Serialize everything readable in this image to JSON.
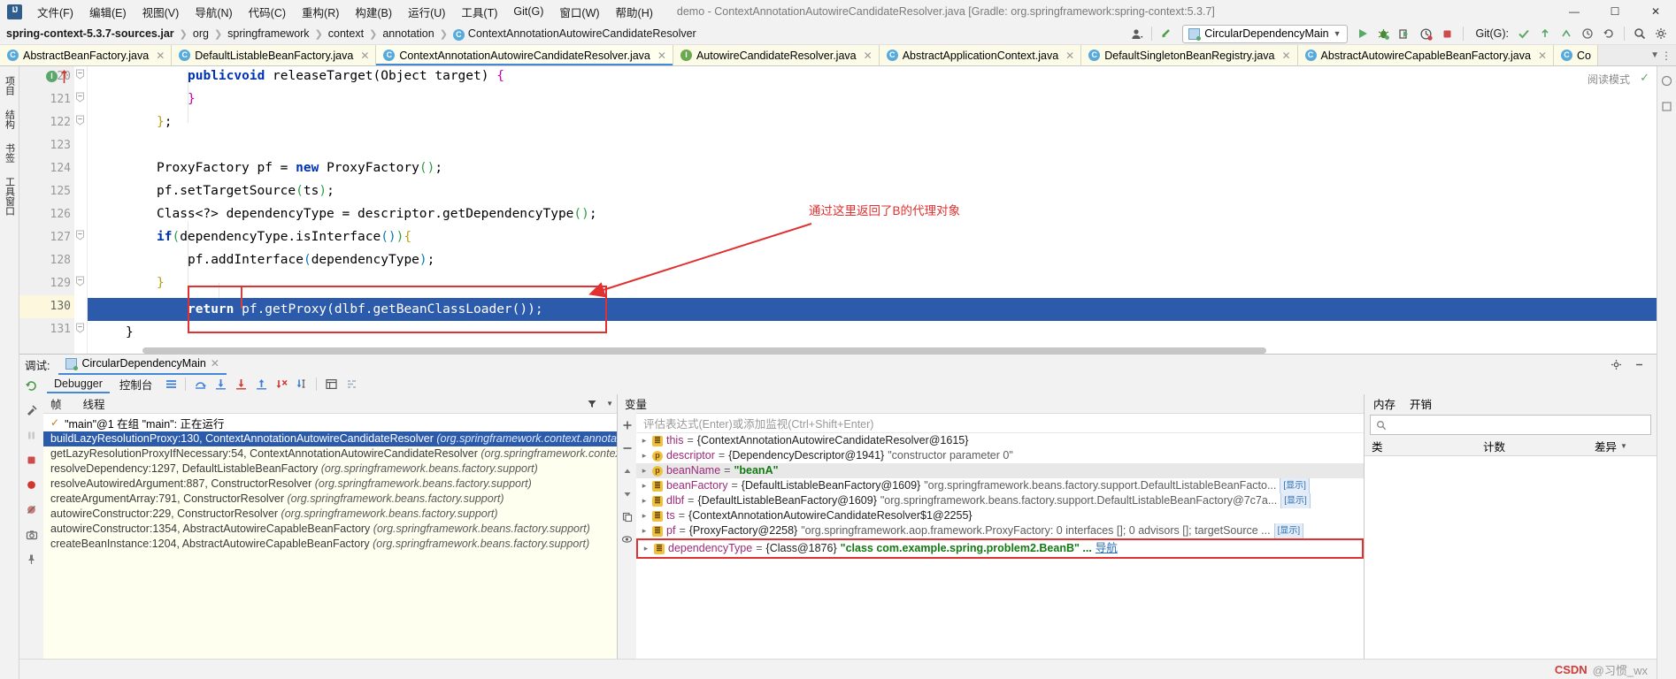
{
  "window": {
    "title": "demo - ContextAnnotationAutowireCandidateResolver.java [Gradle: org.springframework:spring-context:5.3.7]",
    "minimize": "—",
    "maximize": "☐",
    "close": "✕"
  },
  "menu": {
    "items": [
      "文件(F)",
      "编辑(E)",
      "视图(V)",
      "导航(N)",
      "代码(C)",
      "重构(R)",
      "构建(B)",
      "运行(U)",
      "工具(T)",
      "Git(G)",
      "窗口(W)",
      "帮助(H)"
    ]
  },
  "navbar": {
    "breadcrumb": [
      "spring-context-5.3.7-sources.jar",
      "org",
      "springframework",
      "context",
      "annotation",
      "ContextAnnotationAutowireCandidateResolver"
    ],
    "class_badge": "C",
    "run_config": "CircularDependencyMain",
    "git_label": "Git(G):",
    "icons": [
      "avatar-icon",
      "update-project-icon",
      "run-icon",
      "debug-icon",
      "run-with-coverage-icon",
      "profiler-icon",
      "stop-icon",
      "git-checkmark-icon",
      "git-update-icon",
      "git-push-icon",
      "history-icon",
      "revert-icon",
      "search-icon",
      "settings-icon"
    ]
  },
  "editor_tabs": [
    {
      "label": "AbstractBeanFactory.java",
      "kind": "C",
      "active": false
    },
    {
      "label": "DefaultListableBeanFactory.java",
      "kind": "C",
      "active": false
    },
    {
      "label": "ContextAnnotationAutowireCandidateResolver.java",
      "kind": "C",
      "active": true
    },
    {
      "label": "AutowireCandidateResolver.java",
      "kind": "I",
      "active": false
    },
    {
      "label": "AbstractApplicationContext.java",
      "kind": "C",
      "active": false
    },
    {
      "label": "DefaultSingletonBeanRegistry.java",
      "kind": "C",
      "active": false
    },
    {
      "label": "AbstractAutowireCapableBeanFactory.java",
      "kind": "C",
      "active": false
    },
    {
      "label": "Co",
      "kind": "C",
      "active": false
    }
  ],
  "left_strip": {
    "tabs": [
      "项目",
      "结构",
      "书签",
      "工具窗口"
    ],
    "icons": [
      "project-icon",
      "structure-icon",
      "bookmarks-icon",
      "favorites-icon"
    ]
  },
  "editor": {
    "reading_mode": "阅读模式",
    "lines": [
      {
        "num": "120",
        "text": "        public void releaseTarget(Object target) {"
      },
      {
        "num": "121",
        "text": "        }"
      },
      {
        "num": "122",
        "text": "    };"
      },
      {
        "num": "123",
        "text": ""
      },
      {
        "num": "124",
        "text": "    ProxyFactory pf = new ProxyFactory();"
      },
      {
        "num": "125",
        "text": "    pf.setTargetSource(ts);"
      },
      {
        "num": "126",
        "text": "    Class<?> dependencyType = descriptor.getDependencyType();"
      },
      {
        "num": "127",
        "text": "    if (dependencyType.isInterface()) {"
      },
      {
        "num": "128",
        "text": "        pf.addInterface(dependencyType);"
      },
      {
        "num": "129",
        "text": "    }"
      },
      {
        "num": "130",
        "text": "    return pf.getProxy(dlbf.getBeanClassLoader());"
      },
      {
        "num": "131",
        "text": "}"
      }
    ],
    "annotation": "通过这里返回了B的代理对象",
    "annotation_color": "#e03030",
    "highlighted_line": "130"
  },
  "debug": {
    "label": "调试:",
    "session_tab": "CircularDependencyMain",
    "subtabs": [
      {
        "label": "Debugger",
        "active": true
      },
      {
        "label": "控制台",
        "active": false
      }
    ],
    "toolbar_icons": [
      "restart-icon",
      "layout-icon",
      "step-over-icon",
      "step-into-icon",
      "force-step-into-icon",
      "step-out-icon",
      "drop-frame-icon",
      "run-to-cursor-icon",
      "evaluate-icon",
      "mute-breakpoints-icon"
    ],
    "side_icons": [
      "rerun-icon",
      "settings-icon",
      "pause-icon",
      "stop-icon",
      "breakpoints-icon",
      "mute-breakpoints-icon",
      "camera-icon",
      "pin-icon"
    ],
    "frames_header": {
      "frames": "帧",
      "threads": "线程"
    },
    "thread_line": "\"main\"@1 在组 \"main\": 正在运行",
    "frames": [
      {
        "method": "buildLazyResolutionProxy:130, ContextAnnotationAutowireCandidateResolver",
        "pkg": "(org.springframework.context.annotation)",
        "selected": true
      },
      {
        "method": "getLazyResolutionProxyIfNecessary:54, ContextAnnotationAutowireCandidateResolver",
        "pkg": "(org.springframework.context.annotation)",
        "selected": false
      },
      {
        "method": "resolveDependency:1297, DefaultListableBeanFactory",
        "pkg": "(org.springframework.beans.factory.support)",
        "selected": false
      },
      {
        "method": "resolveAutowiredArgument:887, ConstructorResolver",
        "pkg": "(org.springframework.beans.factory.support)",
        "selected": false
      },
      {
        "method": "createArgumentArray:791, ConstructorResolver",
        "pkg": "(org.springframework.beans.factory.support)",
        "selected": false
      },
      {
        "method": "autowireConstructor:229, ConstructorResolver",
        "pkg": "(org.springframework.beans.factory.support)",
        "selected": false
      },
      {
        "method": "autowireConstructor:1354, AbstractAutowireCapableBeanFactory",
        "pkg": "(org.springframework.beans.factory.support)",
        "selected": false
      },
      {
        "method": "createBeanInstance:1204, AbstractAutowireCapableBeanFactory",
        "pkg": "(org.springframework.beans.factory.support)",
        "selected": false
      }
    ],
    "variables_header": "变量",
    "expression_placeholder": "评估表达式(Enter)或添加监视(Ctrl+Shift+Enter)",
    "variables": [
      {
        "icon": "f",
        "name": "this",
        "eq": "=",
        "value": "{ContextAnnotationAutowireCandidateResolver@1615}",
        "extra": "",
        "selected": false,
        "boxed": false,
        "more": false
      },
      {
        "icon": "p",
        "name": "descriptor",
        "eq": "=",
        "value": "{DependencyDescriptor@1941}",
        "extra": "\"constructor parameter 0\"",
        "selected": false,
        "boxed": false,
        "more": false
      },
      {
        "icon": "p",
        "name": "beanName",
        "eq": "=",
        "value": "",
        "extra": "\"beanA\"",
        "selected": true,
        "boxed": false,
        "more": false
      },
      {
        "icon": "f",
        "name": "beanFactory",
        "eq": "=",
        "value": "{DefaultListableBeanFactory@1609}",
        "extra": "\"org.springframework.beans.factory.support.DefaultListableBeanFacto...",
        "selected": false,
        "boxed": false,
        "more": true
      },
      {
        "icon": "f",
        "name": "dlbf",
        "eq": "=",
        "value": "{DefaultListableBeanFactory@1609}",
        "extra": "\"org.springframework.beans.factory.support.DefaultListableBeanFactory@7c7a...",
        "selected": false,
        "boxed": false,
        "more": true
      },
      {
        "icon": "f",
        "name": "ts",
        "eq": "=",
        "value": "{ContextAnnotationAutowireCandidateResolver$1@2255}",
        "extra": "",
        "selected": false,
        "boxed": false,
        "more": false
      },
      {
        "icon": "f",
        "name": "pf",
        "eq": "=",
        "value": "{ProxyFactory@2258}",
        "extra": "\"org.springframework.aop.framework.ProxyFactory: 0 interfaces []; 0 advisors []; targetSource ...",
        "selected": false,
        "boxed": false,
        "more": true
      },
      {
        "icon": "f",
        "name": "dependencyType",
        "eq": "=",
        "value": "{Class@1876}",
        "extra": "\"class com.example.spring.problem2.BeanB\" ...",
        "link": "导航",
        "selected": false,
        "boxed": true,
        "more": false
      }
    ],
    "more_label": "[显示]"
  },
  "memory": {
    "tabs": [
      "内存",
      "开销"
    ],
    "search_placeholder": "",
    "columns": [
      "类",
      "计数",
      "差异"
    ]
  },
  "watermark": {
    "text": "CSDN @习惯_wx",
    "prefix": "CSDN",
    "suffix": "@习惯_wx"
  },
  "colors": {
    "accent": "#4688d8",
    "selection": "#2d5bab",
    "annotation_red": "#e03030",
    "tab_bg": "#fbfbe7",
    "frames_bg": "#fffff0",
    "green": "#59a869"
  }
}
